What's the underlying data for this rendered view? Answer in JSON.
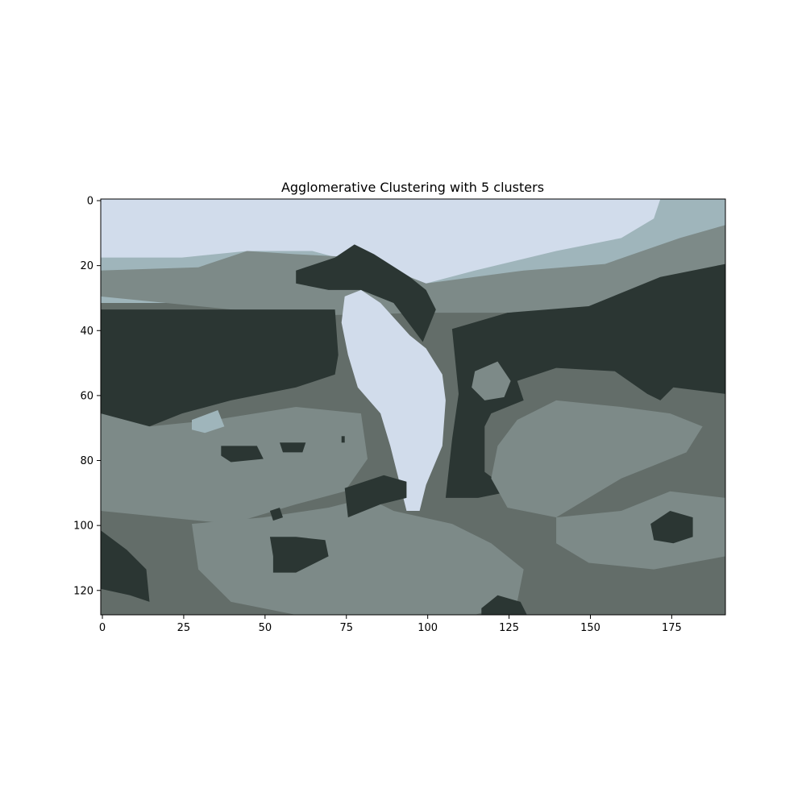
{
  "chart_data": {
    "type": "heatmap",
    "title": "Agglomerative Clustering with 5 clusters",
    "xlabel": "",
    "ylabel": "",
    "image_width": 192,
    "image_height": 128,
    "xlim": [
      -0.5,
      191.5
    ],
    "ylim": [
      127.5,
      -0.5
    ],
    "x_ticks": [
      0,
      25,
      50,
      75,
      100,
      125,
      150,
      175
    ],
    "y_ticks": [
      0,
      20,
      40,
      60,
      80,
      100,
      120
    ],
    "grid": false,
    "legend": "none",
    "clusters": [
      {
        "id": 0,
        "color": "#d1dceb"
      },
      {
        "id": 1,
        "color": "#9fb5bb"
      },
      {
        "id": 2,
        "color": "#7d8a88"
      },
      {
        "id": 3,
        "color": "#636d69"
      },
      {
        "id": 4,
        "color": "#2b3633"
      }
    ],
    "regions": [
      {
        "cluster": 1,
        "points": [
          [
            0,
            0
          ],
          [
            192,
            0
          ],
          [
            192,
            32
          ],
          [
            0,
            32
          ]
        ]
      },
      {
        "cluster": 0,
        "points": [
          [
            0,
            0
          ],
          [
            172,
            0
          ],
          [
            170,
            6
          ],
          [
            160,
            12
          ],
          [
            140,
            16
          ],
          [
            115,
            22
          ],
          [
            100,
            26
          ],
          [
            90,
            24
          ],
          [
            80,
            20
          ],
          [
            65,
            16
          ],
          [
            45,
            16
          ],
          [
            25,
            18
          ],
          [
            0,
            18
          ]
        ]
      },
      {
        "cluster": 2,
        "points": [
          [
            0,
            22
          ],
          [
            30,
            21
          ],
          [
            45,
            16
          ],
          [
            60,
            17
          ],
          [
            80,
            18
          ],
          [
            100,
            26
          ],
          [
            130,
            22
          ],
          [
            155,
            20
          ],
          [
            178,
            12
          ],
          [
            192,
            8
          ],
          [
            192,
            28
          ],
          [
            150,
            35
          ],
          [
            100,
            35
          ],
          [
            60,
            36
          ],
          [
            0,
            30
          ]
        ]
      },
      {
        "cluster": 4,
        "points": [
          [
            0,
            34
          ],
          [
            50,
            34
          ],
          [
            72,
            34
          ],
          [
            73,
            48
          ],
          [
            72,
            54
          ],
          [
            60,
            58
          ],
          [
            40,
            62
          ],
          [
            25,
            66
          ],
          [
            10,
            72
          ],
          [
            0,
            76
          ]
        ]
      },
      {
        "cluster": 4,
        "points": [
          [
            108,
            40
          ],
          [
            125,
            35
          ],
          [
            150,
            33
          ],
          [
            172,
            24
          ],
          [
            192,
            20
          ],
          [
            192,
            60
          ],
          [
            176,
            58
          ],
          [
            172,
            62
          ],
          [
            168,
            60
          ],
          [
            158,
            53
          ],
          [
            140,
            52
          ],
          [
            128,
            56
          ],
          [
            130,
            62
          ],
          [
            120,
            66
          ],
          [
            118,
            70
          ],
          [
            118,
            84
          ],
          [
            126,
            90
          ],
          [
            116,
            92
          ],
          [
            106,
            92
          ],
          [
            108,
            74
          ],
          [
            110,
            60
          ]
        ]
      },
      {
        "cluster": 4,
        "points": [
          [
            60,
            22
          ],
          [
            72,
            18
          ],
          [
            78,
            14
          ],
          [
            84,
            17
          ],
          [
            95,
            24
          ],
          [
            100,
            28
          ],
          [
            103,
            34
          ],
          [
            99,
            44
          ],
          [
            96,
            40
          ],
          [
            90,
            32
          ],
          [
            80,
            28
          ],
          [
            70,
            28
          ],
          [
            60,
            26
          ]
        ]
      },
      {
        "cluster": 0,
        "points": [
          [
            75,
            30
          ],
          [
            80,
            28
          ],
          [
            86,
            32
          ],
          [
            95,
            42
          ],
          [
            100,
            46
          ],
          [
            105,
            54
          ],
          [
            106,
            62
          ],
          [
            105,
            76
          ],
          [
            100,
            88
          ],
          [
            98,
            96
          ],
          [
            94,
            96
          ],
          [
            92,
            88
          ],
          [
            89,
            76
          ],
          [
            86,
            66
          ],
          [
            79,
            58
          ],
          [
            76,
            48
          ],
          [
            74,
            38
          ]
        ]
      },
      {
        "cluster": 2,
        "points": [
          [
            115,
            53
          ],
          [
            122,
            50
          ],
          [
            126,
            56
          ],
          [
            124,
            61
          ],
          [
            118,
            62
          ],
          [
            114,
            58
          ]
        ]
      },
      {
        "cluster": 2,
        "points": [
          [
            128,
            68
          ],
          [
            140,
            62
          ],
          [
            160,
            64
          ],
          [
            175,
            66
          ],
          [
            185,
            70
          ],
          [
            180,
            78
          ],
          [
            170,
            82
          ],
          [
            160,
            86
          ],
          [
            150,
            92
          ],
          [
            140,
            98
          ],
          [
            125,
            95
          ],
          [
            120,
            86
          ],
          [
            122,
            76
          ]
        ]
      },
      {
        "cluster": 2,
        "points": [
          [
            0,
            66
          ],
          [
            15,
            70
          ],
          [
            35,
            68
          ],
          [
            60,
            64
          ],
          [
            80,
            66
          ],
          [
            82,
            80
          ],
          [
            75,
            90
          ],
          [
            60,
            94
          ],
          [
            40,
            100
          ],
          [
            20,
            98
          ],
          [
            0,
            96
          ]
        ]
      },
      {
        "cluster": 2,
        "points": [
          [
            28,
            100
          ],
          [
            50,
            98
          ],
          [
            70,
            95
          ],
          [
            82,
            92
          ],
          [
            90,
            96
          ],
          [
            108,
            100
          ],
          [
            120,
            106
          ],
          [
            130,
            114
          ],
          [
            128,
            124
          ],
          [
            115,
            128
          ],
          [
            60,
            128
          ],
          [
            40,
            124
          ],
          [
            30,
            114
          ]
        ]
      },
      {
        "cluster": 2,
        "points": [
          [
            140,
            98
          ],
          [
            160,
            96
          ],
          [
            175,
            90
          ],
          [
            192,
            92
          ],
          [
            192,
            110
          ],
          [
            170,
            114
          ],
          [
            150,
            112
          ],
          [
            140,
            106
          ]
        ]
      },
      {
        "cluster": 1,
        "points": [
          [
            28,
            68
          ],
          [
            36,
            65
          ],
          [
            38,
            70
          ],
          [
            32,
            72
          ],
          [
            28,
            71
          ]
        ]
      },
      {
        "cluster": 4,
        "points": [
          [
            37,
            76
          ],
          [
            48,
            76
          ],
          [
            50,
            80
          ],
          [
            40,
            81
          ],
          [
            37,
            79
          ]
        ]
      },
      {
        "cluster": 4,
        "points": [
          [
            55,
            75
          ],
          [
            63,
            75
          ],
          [
            62,
            78
          ],
          [
            56,
            78
          ]
        ]
      },
      {
        "cluster": 4,
        "points": [
          [
            75,
            89
          ],
          [
            87,
            85
          ],
          [
            94,
            87
          ],
          [
            94,
            92
          ],
          [
            86,
            94
          ],
          [
            76,
            98
          ]
        ]
      },
      {
        "cluster": 4,
        "points": [
          [
            52,
            104
          ],
          [
            60,
            104
          ],
          [
            69,
            105
          ],
          [
            70,
            110
          ],
          [
            60,
            115
          ],
          [
            53,
            115
          ],
          [
            53,
            110
          ]
        ]
      },
      {
        "cluster": 4,
        "points": [
          [
            169,
            100
          ],
          [
            175,
            96
          ],
          [
            182,
            98
          ],
          [
            182,
            104
          ],
          [
            176,
            106
          ],
          [
            170,
            105
          ]
        ]
      },
      {
        "cluster": 4,
        "points": [
          [
            0,
            102
          ],
          [
            8,
            108
          ],
          [
            14,
            114
          ],
          [
            15,
            124
          ],
          [
            9,
            122
          ],
          [
            0,
            120
          ]
        ]
      },
      {
        "cluster": 4,
        "points": [
          [
            117,
            126
          ],
          [
            122,
            122
          ],
          [
            129,
            124
          ],
          [
            131,
            128
          ],
          [
            117,
            128
          ]
        ]
      },
      {
        "cluster": 4,
        "points": [
          [
            52,
            96
          ],
          [
            55,
            95
          ],
          [
            56,
            98
          ],
          [
            53,
            99
          ]
        ]
      },
      {
        "cluster": 4,
        "points": [
          [
            74,
            73
          ],
          [
            75,
            73
          ],
          [
            75,
            75
          ],
          [
            74,
            75
          ]
        ]
      }
    ]
  }
}
